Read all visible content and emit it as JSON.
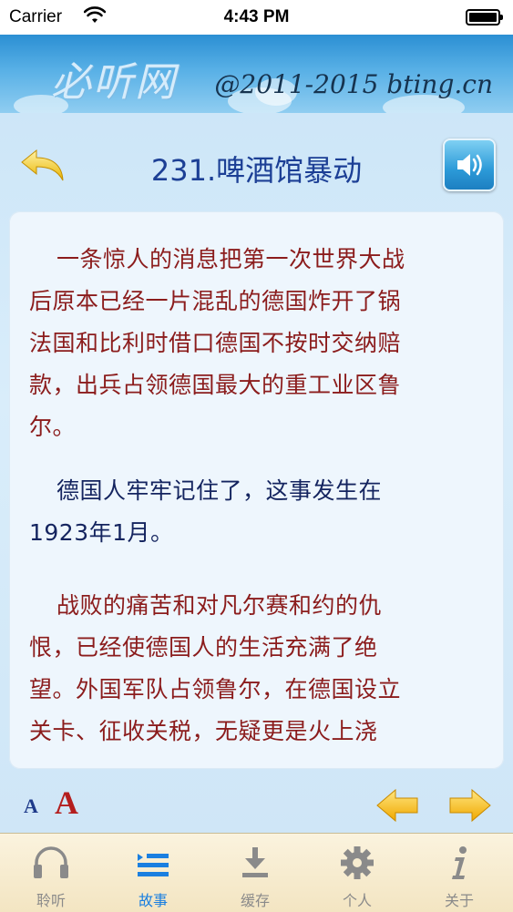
{
  "status_bar": {
    "carrier": "Carrier",
    "time": "4:43 PM"
  },
  "banner": {
    "logo_text": "必听网",
    "copyright": "@2011-2015 bting.cn"
  },
  "story": {
    "title": "231.啤酒馆暴动",
    "paragraphs": [
      {
        "lines": [
          "一条惊人的消息把第一次世界大战",
          "后原本已经一片混乱的德国炸开了锅",
          "法国和比利时借口德国不按时交纳赔",
          "款，出兵占领德国最大的重工业区鲁",
          "尔。"
        ]
      },
      {
        "lines": [
          "德国人牢牢记住了，这事发生在",
          "1923年1月。"
        ]
      },
      {
        "lines": [
          "战败的痛苦和对凡尔赛和约的仇",
          "恨，已经使德国人的生活充满了绝",
          "望。外国军队占领鲁尔，在德国设立",
          "关卡、征收关税，无疑更是火上浇"
        ]
      }
    ]
  },
  "font_controls": {
    "small_label": "A",
    "large_label": "A"
  },
  "tabs": [
    {
      "label": "聆听",
      "icon": "headphones-icon",
      "active": false
    },
    {
      "label": "故事",
      "icon": "list-icon",
      "active": true
    },
    {
      "label": "缓存",
      "icon": "download-icon",
      "active": false
    },
    {
      "label": "个人",
      "icon": "gear-icon",
      "active": false
    },
    {
      "label": "关于",
      "icon": "info-icon",
      "active": false
    }
  ],
  "colors": {
    "accent": "#1a7fe0",
    "title": "#1c3f95",
    "text_red": "#8b1c1c",
    "text_blue": "#14245f",
    "arrow_yellow": "#f5b800"
  }
}
